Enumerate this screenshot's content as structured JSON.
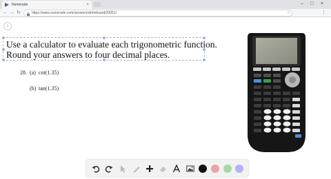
{
  "browser": {
    "tab_title": "Numerade",
    "url": "https://www.numerade.com/answers/whiteboard/20051/"
  },
  "whiteboard": {
    "page_number": "1",
    "prompt_line1": "Use a calculator to evaluate each trigonometric function.",
    "prompt_line2": "Round your answers to four decimal places.",
    "problem_number": "28.",
    "part_a_label": "(a)",
    "part_a_expr": "cot(1.35)",
    "part_b_label": "(b)",
    "part_b_expr": "tan(1.35)"
  },
  "toolbar": {
    "tools": [
      "undo-icon",
      "redo-icon",
      "pointer-icon",
      "pen-icon",
      "add-icon",
      "eraser-icon",
      "text-icon",
      "image-icon"
    ],
    "colors": [
      "#111111",
      "#e8a3a3",
      "#a8d8a8",
      "#b3b3ee"
    ]
  }
}
